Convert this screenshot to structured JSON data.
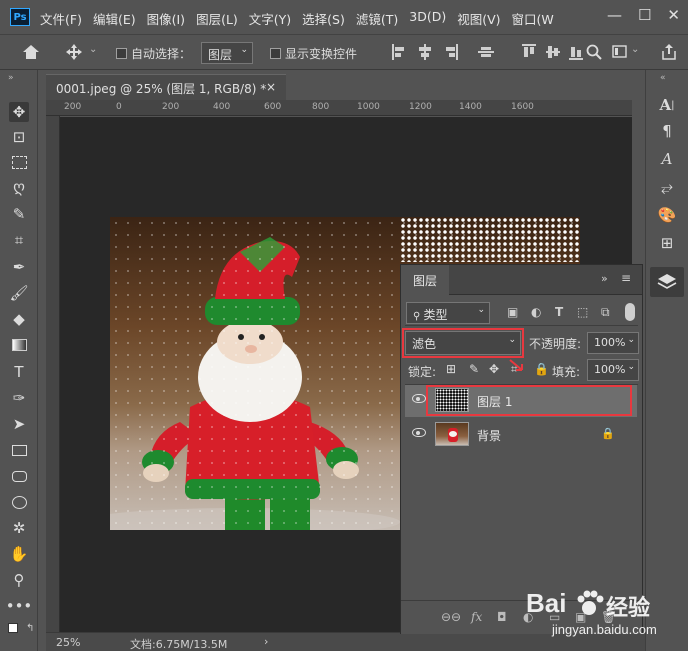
{
  "app": {
    "logo": "Ps"
  },
  "menu": {
    "items": [
      "文件(F)",
      "编辑(E)",
      "图像(I)",
      "图层(L)",
      "文字(Y)",
      "选择(S)",
      "滤镜(T)",
      "3D(D)",
      "视图(V)",
      "窗口(W"
    ]
  },
  "window_controls": {
    "minimize": "—",
    "restore": "☐",
    "close": "✕"
  },
  "options": {
    "auto_select_label": "自动选择：",
    "auto_select_value": "图层",
    "show_transform_label": "显示变换控件"
  },
  "document": {
    "tab_title": "0001.jpeg @ 25% (图层 1, RGB/8) *",
    "close_glyph": "×",
    "ruler_labels": [
      "200",
      "0",
      "200",
      "400",
      "600",
      "800",
      "1000",
      "1200",
      "1400",
      "1600"
    ]
  },
  "status": {
    "zoom": "25%",
    "doc_info": "文档:6.75M/13.5M",
    "arrow": "›"
  },
  "layers_panel": {
    "tab_label": "图层",
    "filter_kind": "类型",
    "blend_mode": "滤色",
    "opacity_label": "不透明度:",
    "opacity_value": "100%",
    "lock_label": "锁定:",
    "fill_label": "填充:",
    "fill_value": "100%",
    "layers": [
      {
        "name": "图层 1",
        "selected": true
      },
      {
        "name": "背景",
        "locked": true
      }
    ],
    "footer": [
      "⊖⊖",
      "fx",
      "◘",
      "◐",
      "▭",
      "▣",
      "🗑"
    ]
  },
  "watermark": {
    "brand": "Bai",
    "brand2": "经验",
    "url": "jingyan.baidu.com"
  },
  "colors": {
    "highlight": "#e8383f",
    "accent": "#31a8ff"
  }
}
